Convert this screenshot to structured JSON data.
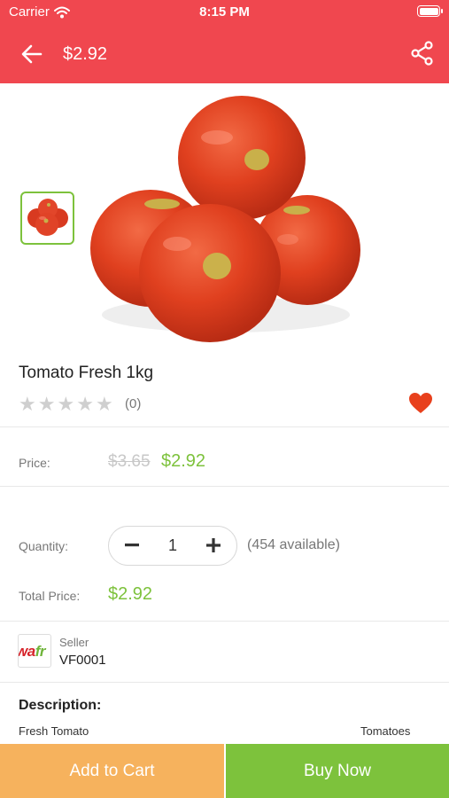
{
  "status_bar": {
    "carrier": "Carrier",
    "time": "8:15 PM"
  },
  "nav": {
    "title": "$2.92",
    "back_icon": "arrow-left-icon",
    "share_icon": "share-icon"
  },
  "colors": {
    "header": "#f0474f",
    "accent_green": "#7dc23c",
    "cart_orange": "#f6b25d"
  },
  "product": {
    "name": "Tomato Fresh 1kg",
    "rating": 0,
    "rating_count": "(0)",
    "favorite": true
  },
  "pricing": {
    "price_label": "Price:",
    "original_price": "$3.65",
    "price": "$2.92"
  },
  "quantity": {
    "label": "Quantity:",
    "value": "1",
    "available": "(454 available)"
  },
  "total": {
    "label": "Total Price:",
    "value": "$2.92"
  },
  "seller": {
    "label": "Seller",
    "name": "VF0001",
    "logo_text_red": "wa",
    "logo_text_green": "fr"
  },
  "description": {
    "heading": "Description:",
    "line1_left": "Fresh Tomato",
    "line1_right": "Tomatoes"
  },
  "actions": {
    "add_to_cart": "Add to Cart",
    "buy_now": "Buy Now"
  }
}
